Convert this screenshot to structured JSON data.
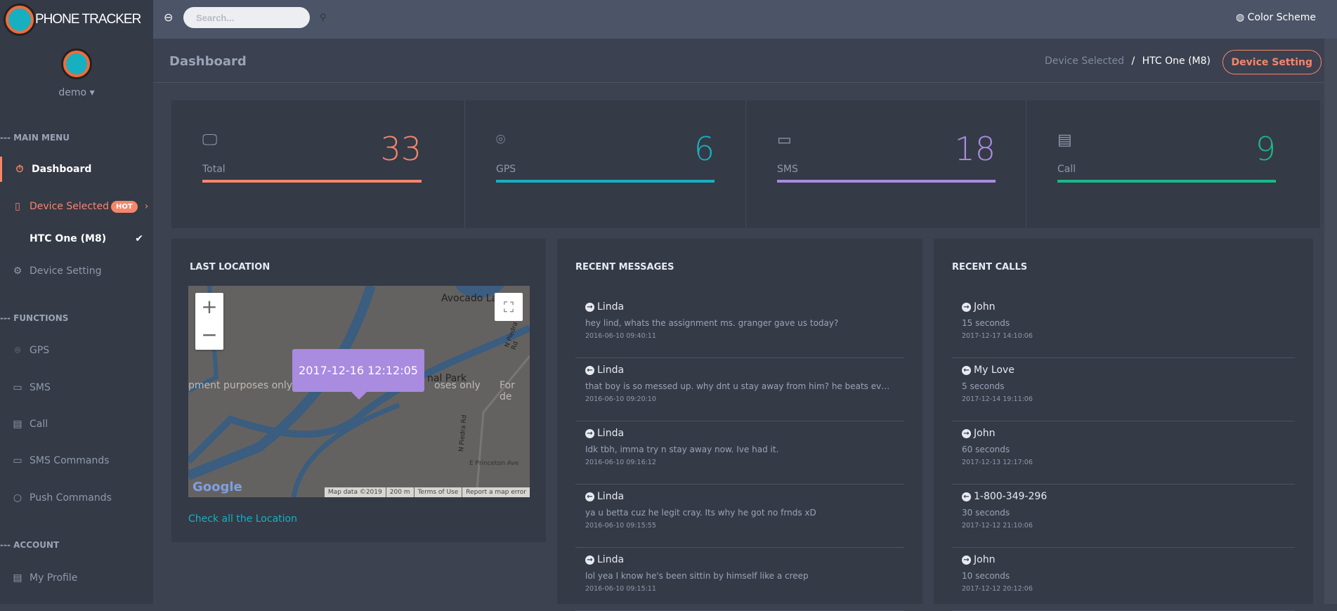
{
  "app": {
    "title": "PHONE TRACKER"
  },
  "user": {
    "name": "demo"
  },
  "sidebar": {
    "sections": [
      "--- MAIN MENU",
      "--- FUNCTIONS",
      "--- ACCOUNT"
    ],
    "items": [
      {
        "label": "Dashboard",
        "icon": "stopwatch-icon"
      },
      {
        "label": "Device Selected",
        "icon": "tablet-icon",
        "badge": "HOT"
      },
      {
        "label": "HTC One (M8)",
        "icon": "check-icon"
      },
      {
        "label": "Device Setting",
        "icon": "gear-icon"
      },
      {
        "label": "GPS",
        "icon": "map-pin-icon"
      },
      {
        "label": "SMS",
        "icon": "chat-icon"
      },
      {
        "label": "Call",
        "icon": "document-icon"
      },
      {
        "label": "SMS Commands",
        "icon": "message-icon"
      },
      {
        "label": "Push Commands",
        "icon": "refresh-icon"
      },
      {
        "label": "My Profile",
        "icon": "id-card-icon"
      }
    ]
  },
  "topbar": {
    "search_placeholder": "Search...",
    "color_scheme": "Color Scheme"
  },
  "header": {
    "title": "Dashboard",
    "breadcrumb_parent": "Device Selected",
    "breadcrumb_sep": "/",
    "breadcrumb_current": "HTC One (M8)",
    "device_setting_button": "Device Setting"
  },
  "stats": [
    {
      "label": "Total",
      "value": "33",
      "color": "#f6866a"
    },
    {
      "label": "GPS",
      "value": "6",
      "color": "#17b0c0"
    },
    {
      "label": "SMS",
      "value": "18",
      "color": "#a98be0"
    },
    {
      "label": "Call",
      "value": "9",
      "color": "#1bb887"
    }
  ],
  "location": {
    "title": "LAST LOCATION",
    "timestamp": "2017-12-16 12:12:05",
    "link": "Check all the Location",
    "map_labels": [
      "Avocado Lak",
      "pment purposes only",
      "nal Park",
      "oses only",
      "For de",
      "N Piedra Rd",
      "N Piedra Rd",
      "E Princeton Ave"
    ],
    "attribution": [
      "Map data ©2019",
      "200 m",
      "Terms of Use",
      "Report a map error"
    ],
    "google": "Google"
  },
  "messages": {
    "title": "RECENT MESSAGES",
    "items": [
      {
        "dir": "out",
        "name": "Linda",
        "text": "hey lind, whats the assignment ms. granger gave us today?",
        "time": "2016-06-10 09:40:11"
      },
      {
        "dir": "in",
        "name": "Linda",
        "text": "that boy is so messed up. why dnt u stay away from him? he beats every kid in school",
        "time": "2016-06-10 09:20:10"
      },
      {
        "dir": "out",
        "name": "Linda",
        "text": "Idk tbh, imma try n stay away now. Ive had it.",
        "time": "2016-06-10 09:16:12"
      },
      {
        "dir": "in",
        "name": "Linda",
        "text": "ya u betta cuz he legit cray. Its why he got no frnds xD",
        "time": "2016-06-10 09:15:55"
      },
      {
        "dir": "out",
        "name": "Linda",
        "text": "lol yea I know he's been sittin by himself like a creep",
        "time": "2016-06-10 09:15:11"
      }
    ]
  },
  "calls": {
    "title": "RECENT CALLS",
    "items": [
      {
        "dir": "out",
        "name": "John",
        "text": "15 seconds",
        "time": "2017-12-17 14:10:06"
      },
      {
        "dir": "in",
        "name": "My Love",
        "text": "5 seconds",
        "time": "2017-12-14 19:11:06"
      },
      {
        "dir": "out",
        "name": "John",
        "text": "60 seconds",
        "time": "2017-12-13 12:17:06"
      },
      {
        "dir": "in",
        "name": "1-800-349-296",
        "text": "30 seconds",
        "time": "2017-12-12 21:10:06"
      },
      {
        "dir": "out",
        "name": "John",
        "text": "10 seconds",
        "time": "2017-12-12 20:12:06"
      }
    ]
  }
}
